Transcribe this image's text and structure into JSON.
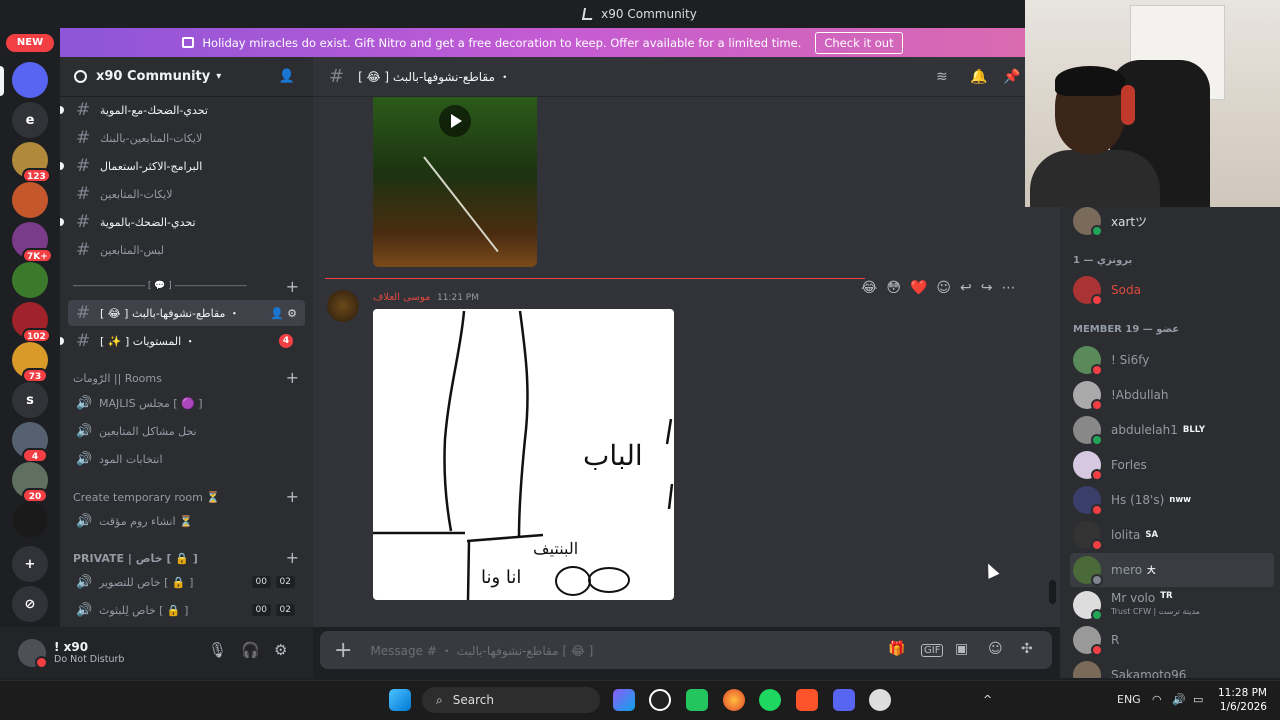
{
  "window": {
    "title": "x90 Community"
  },
  "rail": {
    "new_label": "NEW",
    "servers": [
      {
        "letter": "",
        "badge": "",
        "color": "#5865f2"
      },
      {
        "letter": "e",
        "badge": "",
        "color": "#313338"
      },
      {
        "letter": "",
        "badge": "123",
        "color": "#b08a3a"
      },
      {
        "letter": "",
        "badge": "",
        "color": "#c4572c"
      },
      {
        "letter": "",
        "badge": "7K+",
        "color": "#7a3b8a"
      },
      {
        "letter": "",
        "badge": "",
        "color": "#3a7a2a"
      },
      {
        "letter": "",
        "badge": "102",
        "color": "#a0222a"
      },
      {
        "letter": "",
        "badge": "73",
        "color": "#d99a2a"
      },
      {
        "letter": "s",
        "badge": "",
        "color": "#313338"
      },
      {
        "letter": "",
        "badge": "4",
        "color": "#556070"
      },
      {
        "letter": "",
        "badge": "20",
        "color": "#607060"
      },
      {
        "letter": "",
        "badge": "",
        "color": "#1a1a1a"
      }
    ],
    "add_server_icon": "+",
    "discover_icon": "compass"
  },
  "banner": {
    "text": "Holiday miracles do exist. Gift Nitro and get a free decoration to keep. Offer available for a limited time.",
    "cta": "Check it out"
  },
  "guild": {
    "name": "x90 Community"
  },
  "channels": {
    "text_top": [
      {
        "name": "تحدي-الضحك-مع-الموية",
        "unread": true
      },
      {
        "name": "لايكات-المتابعين-بالبنك",
        "unread": false
      },
      {
        "name": "البرامج-الاكثر-استعمال",
        "unread": true
      },
      {
        "name": "لايكات-المتابعين",
        "unread": false
      },
      {
        "name": "تحدي-الضحك-بالموية",
        "unread": true
      },
      {
        "name": "لبس-المتابعين",
        "unread": false
      }
    ],
    "divider_category": "―――――――― [ 💬 ] ――――――――",
    "active_channel": "[ 😂 ] مقاطع-نشوفها-بالبث ・",
    "levels_channel": "[ ✨ ] المستويات ・",
    "levels_mentions": "4",
    "rooms_category": "الرّومات || Rooms",
    "rooms": [
      {
        "name": "MAJLIS مجلس [ 🟣 ]"
      },
      {
        "name": "نحل مشاكل المتابعين"
      },
      {
        "name": "انتخابات المود"
      }
    ],
    "temp_category": "Create temporary room ⏳",
    "temp_rooms": [
      {
        "name": "انشاء روم مؤقت ⏳"
      }
    ],
    "private_category": "PRIVATE | خاص [ 🔒 ]",
    "private_rooms": [
      {
        "name": "خاص للتصوير [ 🔒 ]",
        "a": "00",
        "b": "02"
      },
      {
        "name": "خاص لِلبثوث [ 🔒 ]",
        "a": "00",
        "b": "02"
      }
    ]
  },
  "user": {
    "name": "! x90",
    "status": "Do Not Disturb"
  },
  "chat": {
    "channel_title": "[ 😂 ] مقاطع-نشوفها-بالبث ・",
    "message": {
      "author": "موسى العلاف",
      "time": "11:21 PM",
      "drawing_text_1": "الباب",
      "drawing_text_2": "البنتيف",
      "drawing_text_3": "انا ونا"
    },
    "hover_reactions": [
      "😂",
      "😳",
      "❤️"
    ],
    "composer_placeholder": "Message # ・ مقاطع-نشوفها-بالبث [ 😂 ]"
  },
  "members": {
    "top": [
      {
        "name": "xartツ",
        "tag": "",
        "color": "#dbdee1",
        "status": "#23a559"
      }
    ],
    "role1": {
      "label": "برونزي — 1"
    },
    "role1_members": [
      {
        "name": "Soda",
        "tag": "",
        "color": "#e0493f",
        "status": "#f23f43"
      }
    ],
    "role2": {
      "label": "MEMBER 19 — عضو"
    },
    "role2_members": [
      {
        "name": "! Si6fy",
        "tag": "",
        "color": "#949ba4",
        "status": "#f23f43"
      },
      {
        "name": "!Abdullah",
        "tag": "",
        "color": "#949ba4",
        "status": "#f23f43"
      },
      {
        "name": "abdulelah1",
        "tag": "BLLY",
        "color": "#949ba4",
        "status": "#23a559"
      },
      {
        "name": "Forles",
        "tag": "",
        "color": "#949ba4",
        "status": "#f23f43"
      },
      {
        "name": "Hs (18's)",
        "tag": "nww",
        "color": "#949ba4",
        "status": "#f23f43"
      },
      {
        "name": "lolita",
        "tag": "SA",
        "color": "#949ba4",
        "status": "#f23f43"
      },
      {
        "name": "mero",
        "tag": "大",
        "color": "#949ba4",
        "status": "#80848e"
      },
      {
        "name": "Mr volo",
        "tag": "TR",
        "color": "#949ba4",
        "status": "#23a559"
      },
      {
        "name": "R",
        "tag": "",
        "color": "#949ba4",
        "status": "#f23f43"
      },
      {
        "name": "Sakamoto96",
        "tag": "",
        "color": "#949ba4",
        "status": "#f23f43"
      }
    ],
    "mrvolo_sub": "Trust CFW | مدينة ترست"
  },
  "taskbar": {
    "search_label": "Search",
    "lang": "ENG",
    "time": "11:28 PM",
    "date": "1/6/2026"
  }
}
